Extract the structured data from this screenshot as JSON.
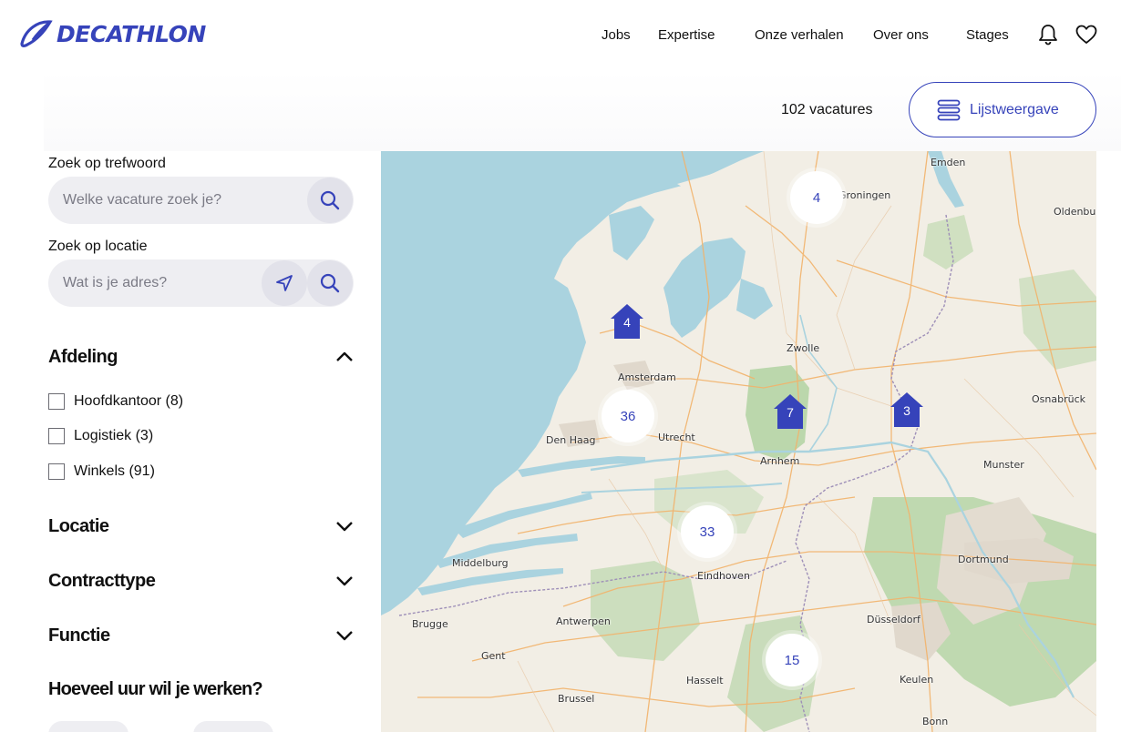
{
  "brand": {
    "name": "DECATHLON",
    "color": "#3643ba"
  },
  "nav": {
    "items": [
      "Jobs",
      "Expertise",
      "Onze verhalen",
      "Over ons",
      "Stages"
    ],
    "icons": [
      "bell-icon",
      "heart-icon"
    ]
  },
  "results": {
    "count_label": "102 vacatures",
    "list_button_label": "Lijstweergave"
  },
  "filters": {
    "keyword_label": "Zoek op trefwoord",
    "keyword_placeholder": "Welke vacature zoek je?",
    "location_label": "Zoek op locatie",
    "location_placeholder": "Wat is je adres?",
    "department": {
      "title": "Afdeling",
      "options": [
        "Hoofdkantoor (8)",
        "Logistiek (3)",
        "Winkels (91)"
      ]
    },
    "location_title": "Locatie",
    "contract_title": "Contracttype",
    "function_title": "Functie",
    "hours_title": "Hoeveel uur wil je werken?"
  },
  "map": {
    "cities": [
      "Emden",
      "Groningen",
      "Oldenburg",
      "Zwolle",
      "Amsterdam",
      "Osnabrück",
      "Den Haag",
      "Utrecht",
      "Arnhem",
      "Munster",
      "Middelburg",
      "Eindhoven",
      "Dortmund",
      "Brugge",
      "Antwerpen",
      "Düsseldorf",
      "Gent",
      "Hasselt",
      "Keulen",
      "Brussel",
      "Bonn"
    ],
    "clusters": [
      "4",
      "36",
      "33",
      "15"
    ],
    "store_markers": [
      "4",
      "7",
      "3"
    ]
  }
}
